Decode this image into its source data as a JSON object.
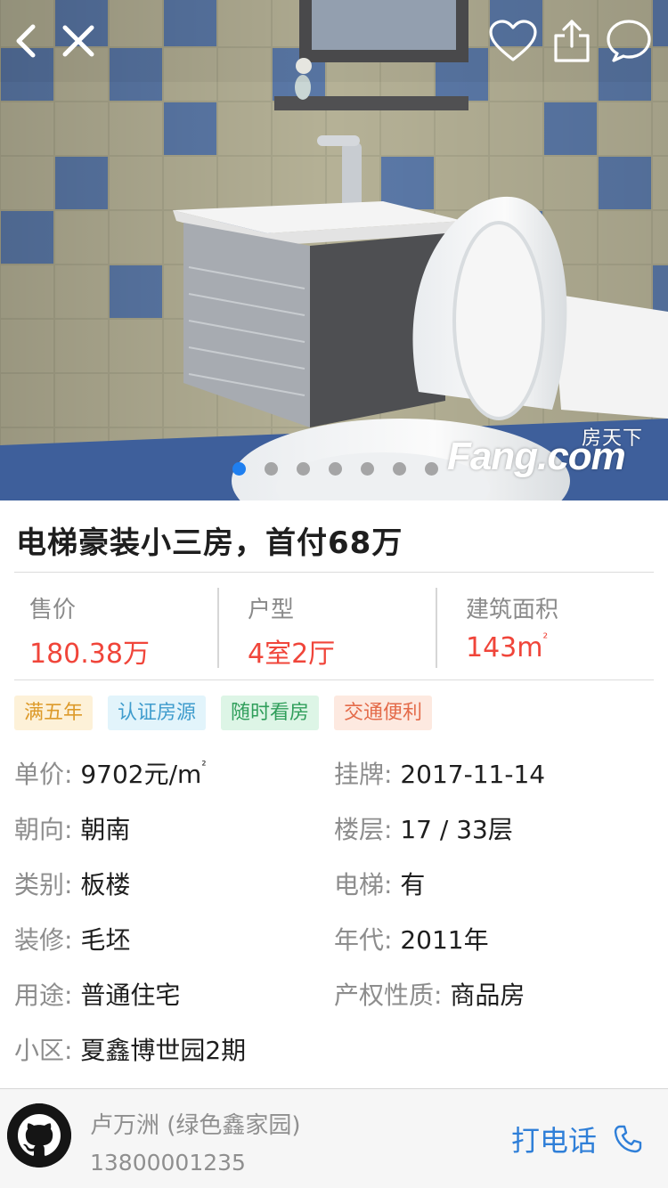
{
  "gallery": {
    "slide_count": 7,
    "active_index": 0,
    "watermark_top": "房天下",
    "watermark_main": "Fang.com"
  },
  "nav": {
    "back_icon": "chevron-left-icon",
    "close_icon": "close-icon",
    "favorite_icon": "heart-icon",
    "share_icon": "share-icon",
    "chat_icon": "chat-bubble-icon"
  },
  "listing": {
    "title": "电梯豪装小三房，首付68万"
  },
  "stats": [
    {
      "label": "售价",
      "value": "180.38万"
    },
    {
      "label": "户型",
      "value": "4室2厅"
    },
    {
      "label": "建筑面积",
      "value": "143m",
      "sup": "²"
    }
  ],
  "tags": [
    "满五年",
    "认证房源",
    "随时看房",
    "交通便利"
  ],
  "details": {
    "unit_price": {
      "key": "单价:",
      "value": "9702元/m",
      "sup": "²"
    },
    "listed": {
      "key": "挂牌:",
      "value": "2017-11-14"
    },
    "orientation": {
      "key": "朝向:",
      "value": "朝南"
    },
    "floor": {
      "key": "楼层:",
      "value": "17 / 33层"
    },
    "type": {
      "key": "类别:",
      "value": "板楼"
    },
    "elevator": {
      "key": "电梯:",
      "value": "有"
    },
    "decoration": {
      "key": "装修:",
      "value": "毛坯"
    },
    "year": {
      "key": "年代:",
      "value": "2011年"
    },
    "usage": {
      "key": "用途:",
      "value": "普通住宅"
    },
    "ownership": {
      "key": "产权性质:",
      "value": "商品房"
    },
    "community": {
      "key": "小区:",
      "value": "夏鑫博世园2期"
    }
  },
  "agent": {
    "name": "卢万洲 (绿色鑫家园)",
    "phone": "13800001235",
    "call_label": "打电话",
    "call_icon": "phone-icon"
  },
  "colors": {
    "price_red": "#f0453a",
    "call_blue": "#2f7fd8",
    "dot_active": "#1f7ff0"
  }
}
